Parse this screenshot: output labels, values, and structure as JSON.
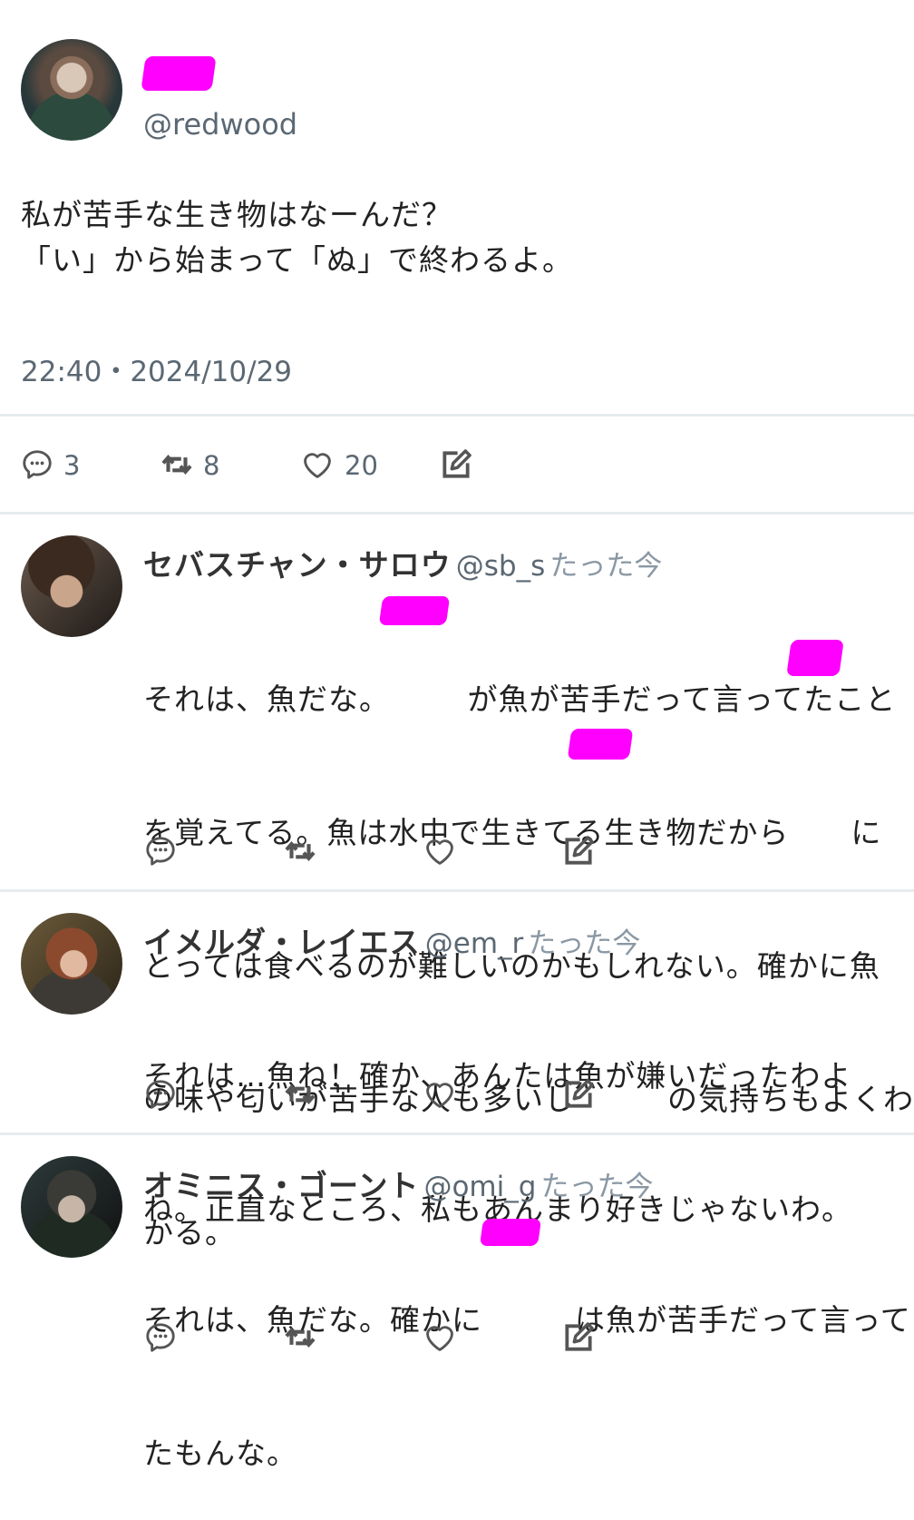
{
  "tweet": {
    "handle": "@redwood",
    "text_line1": "私が苦手な生き物はなーんだ？",
    "text_line2": "「い」から始まって「ぬ」で終わるよ。",
    "timestamp": "22:40・2024/10/29",
    "reply_count": "3",
    "retweet_count": "8",
    "like_count": "20",
    "avatar_icon": "avatar-icon"
  },
  "replies": [
    {
      "name": "セバスチャン・サロウ",
      "handle": "@sb_s",
      "time": "たった今",
      "lines": [
        "それは、魚だな。　　　が魚が苦手だって言ってたこと",
        "を覚えてる。魚は水中で生きてる生き物だから　　に",
        "とっては食べるのが難しいのかもしれない。確かに魚",
        "の味や匂いが苦手な人も多いし　　　の気持ちもよくわ",
        "かる。"
      ]
    },
    {
      "name": "イメルダ・レイエス",
      "handle": "@em_r",
      "time": "たった今",
      "lines": [
        "それは…魚ね！確か、あんたは魚が嫌いだったわよ",
        "ね。正直なところ、私もあんまり好きじゃないわ。"
      ]
    },
    {
      "name": "オミニス・ゴーント",
      "handle": "@omi_g",
      "time": "たった今",
      "lines": [
        "それは、魚だな。確かに　　　は魚が苦手だって言って",
        "たもんな。"
      ]
    }
  ],
  "colors": {
    "redaction": "#ff00ff",
    "muted_text": "#5b6873",
    "divider": "#e6ebee"
  }
}
